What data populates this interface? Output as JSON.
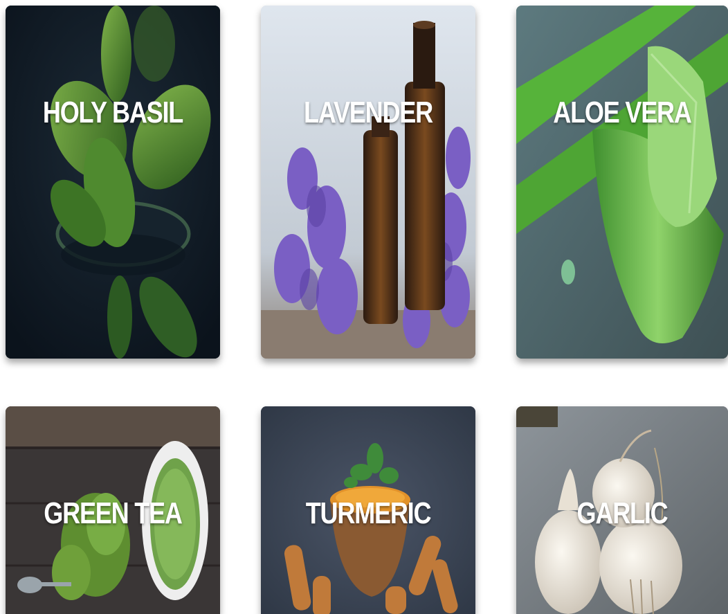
{
  "herbs": [
    {
      "title": "HOLY BASIL"
    },
    {
      "title": "LAVENDER"
    },
    {
      "title": "ALOE VERA"
    },
    {
      "title": "GREEN TEA"
    },
    {
      "title": "TURMERIC"
    },
    {
      "title": "GARLIC"
    }
  ],
  "colors": {
    "title_text": "#ffffff",
    "page_background": "#ffffff"
  }
}
